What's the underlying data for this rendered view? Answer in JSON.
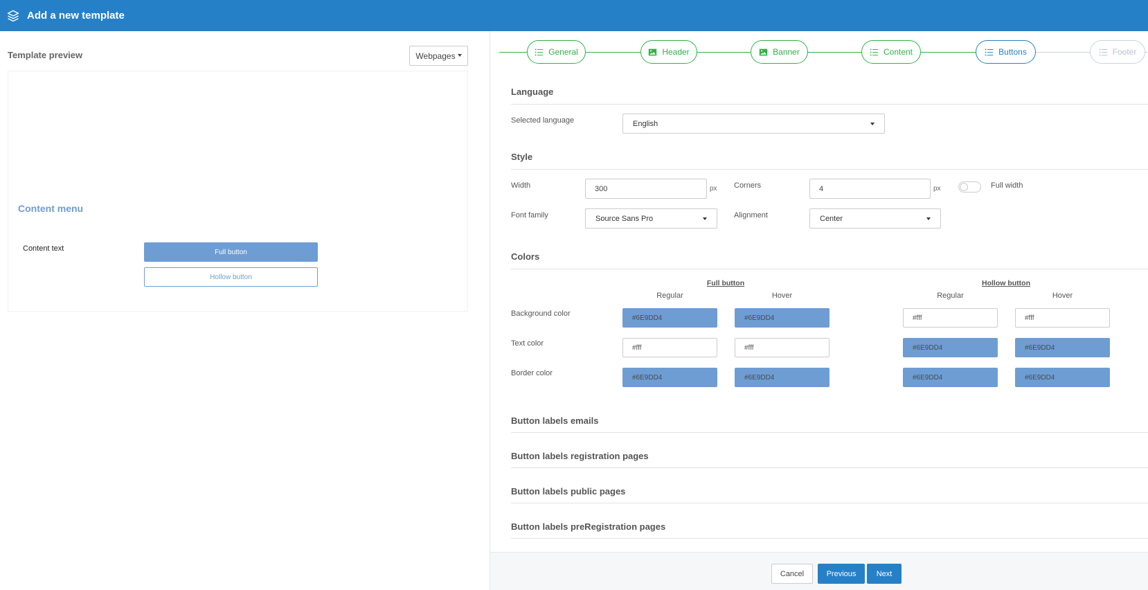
{
  "header": {
    "title": "Add a new template",
    "icon": "layers-icon"
  },
  "preview": {
    "title": "Template preview",
    "dropdown_label": "Webpages",
    "content_menu": "Content menu",
    "content_text": "Content text",
    "full_button": "Full button",
    "hollow_button": "Hollow button"
  },
  "stepper": {
    "steps": [
      {
        "label": "General",
        "icon": "list-icon",
        "state": "done"
      },
      {
        "label": "Header",
        "icon": "image-icon",
        "state": "done"
      },
      {
        "label": "Banner",
        "icon": "image-icon",
        "state": "done"
      },
      {
        "label": "Content",
        "icon": "list-icon",
        "state": "done"
      },
      {
        "label": "Buttons",
        "icon": "list-icon",
        "state": "active"
      },
      {
        "label": "Footer",
        "icon": "list-icon",
        "state": "todo"
      }
    ]
  },
  "language": {
    "section": "Language",
    "label": "Selected language",
    "value": "English"
  },
  "style": {
    "section": "Style",
    "width_label": "Width",
    "width_value": "300",
    "width_unit": "px",
    "corners_label": "Corners",
    "corners_value": "4",
    "corners_unit": "px",
    "full_width_label": "Full width",
    "full_width_on": false,
    "font_label": "Font family",
    "font_value": "Source Sans Pro",
    "align_label": "Alignment",
    "align_value": "Center"
  },
  "colors": {
    "section": "Colors",
    "full_group": "Full button",
    "hollow_group": "Hollow button",
    "regular": "Regular",
    "hover": "Hover",
    "rows": [
      {
        "label": "Background color",
        "values": [
          "#6E9DD4",
          "#6E9DD4",
          "#fff",
          "#fff"
        ]
      },
      {
        "label": "Text color",
        "values": [
          "#fff",
          "#fff",
          "#6E9DD4",
          "#6E9DD4"
        ]
      },
      {
        "label": "Border color",
        "values": [
          "#6E9DD4",
          "#6E9DD4",
          "#6E9DD4",
          "#6E9DD4"
        ]
      }
    ]
  },
  "collapsed_sections": [
    "Button labels emails",
    "Button labels registration pages",
    "Button labels public pages",
    "Button labels preRegistration pages"
  ],
  "footer": {
    "cancel": "Cancel",
    "previous": "Previous",
    "next": "Next"
  },
  "theme": {
    "primary": "#2680c8",
    "success": "#2fb344",
    "button_color": "#6e9dd4"
  }
}
